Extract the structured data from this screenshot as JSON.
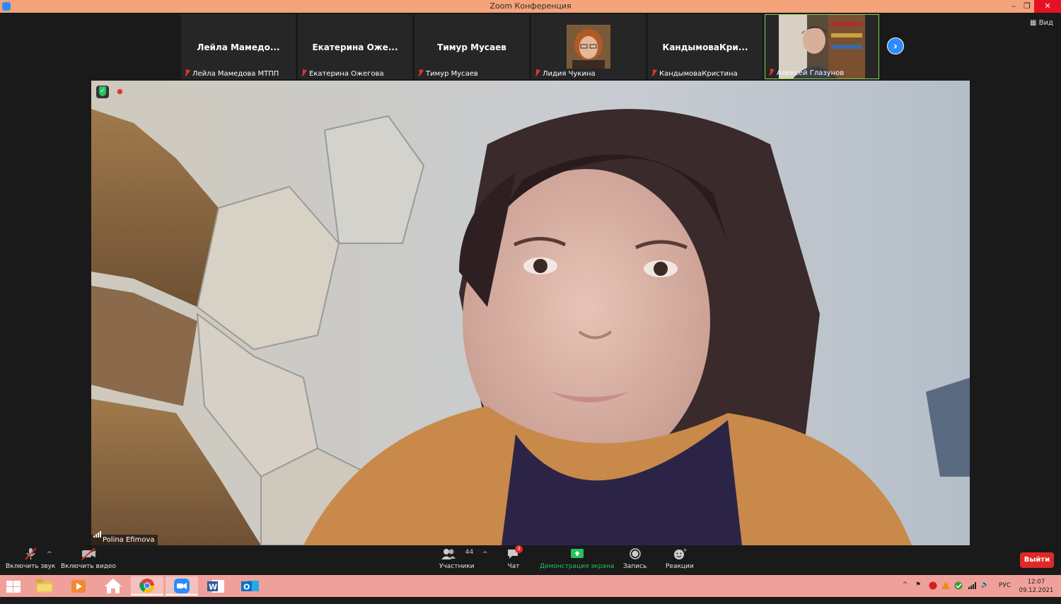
{
  "window": {
    "title": "Zoom Конференция"
  },
  "gallery": {
    "tiles": [
      {
        "display_name": "Лейла  Мамедо...",
        "label": "Лейла Мамедова МТПП"
      },
      {
        "display_name": "Екатерина  Оже...",
        "label": "Екатерина Ожегова"
      },
      {
        "display_name": "Тимур Мусаев",
        "label": "Тимур Мусаев"
      },
      {
        "display_name": "",
        "label": "Лидия Чукина"
      },
      {
        "display_name": "КандымоваКри...",
        "label": "КандымоваКристина"
      },
      {
        "display_name": "",
        "label": "Алексей Глазунов"
      }
    ],
    "view_label": "Вид"
  },
  "main": {
    "speaker_name": "Polina Efimova"
  },
  "toolbar": {
    "unmute_label": "Включить звук",
    "start_video_label": "Включить видео",
    "participants_label": "Участники",
    "participants_count": "44",
    "chat_label": "Чат",
    "chat_badge": "3",
    "share_label": "Демонстрация экрана",
    "record_label": "Запись",
    "reactions_label": "Реакции",
    "leave_label": "Выйти"
  },
  "taskbar": {
    "language": "РУС",
    "time": "12:07",
    "date": "09.12.2021"
  },
  "colors": {
    "titlebar": "#f4a37a",
    "taskbar": "#f0a09a",
    "zoom_blue": "#2d8cff",
    "leave_red": "#e02828",
    "share_green": "#25c25e"
  }
}
